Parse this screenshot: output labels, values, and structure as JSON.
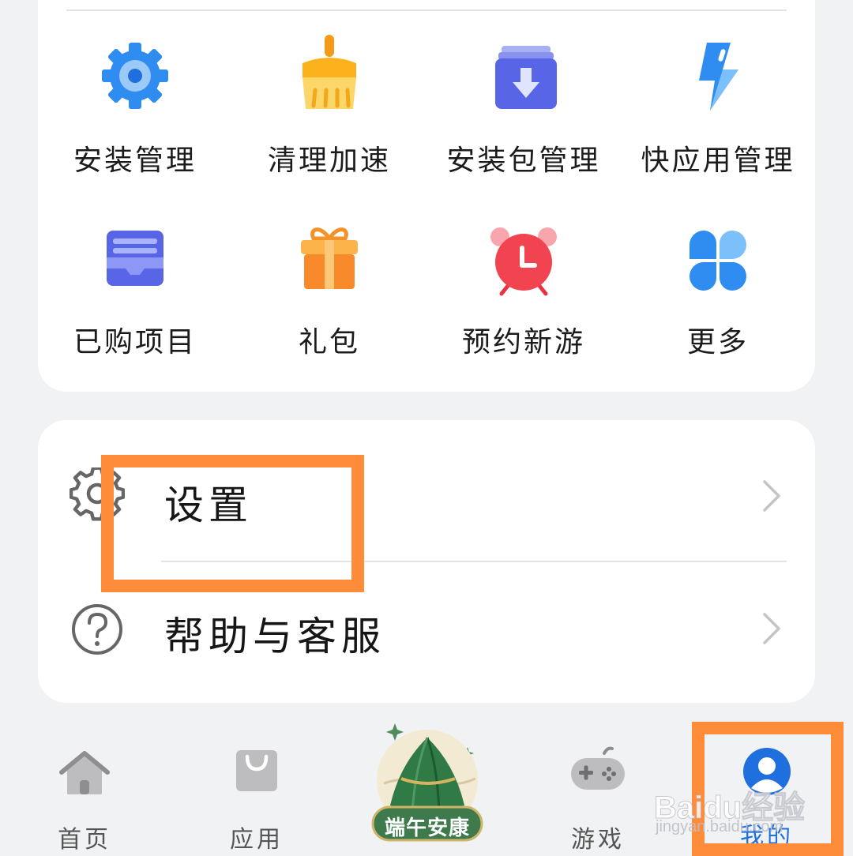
{
  "grid": {
    "items": [
      {
        "label": "安装管理",
        "icon": "gear-icon"
      },
      {
        "label": "清理加速",
        "icon": "brush-icon"
      },
      {
        "label": "安装包管理",
        "icon": "package-download-icon"
      },
      {
        "label": "快应用管理",
        "icon": "lightning-icon"
      },
      {
        "label": "已购项目",
        "icon": "purchased-tray-icon"
      },
      {
        "label": "礼包",
        "icon": "gift-icon"
      },
      {
        "label": "预约新游",
        "icon": "alarm-clock-icon"
      },
      {
        "label": "更多",
        "icon": "four-petal-grid-icon"
      }
    ]
  },
  "settings_list": {
    "items": [
      {
        "label": "设置",
        "icon": "settings-gear-icon",
        "trailing": "chevron-right-icon"
      },
      {
        "label": "帮助与客服",
        "icon": "question-circle-icon",
        "trailing": "chevron-right-icon"
      }
    ]
  },
  "bottom_nav": {
    "items": [
      {
        "label": "首页",
        "icon": "home-icon"
      },
      {
        "label": "应用",
        "icon": "shopping-bag-icon"
      },
      {
        "label": "端午安康",
        "icon": "zongzi-festival-icon"
      },
      {
        "label": "游戏",
        "icon": "gamepad-icon"
      },
      {
        "label": "我的",
        "icon": "user-avatar-icon",
        "active": true
      }
    ]
  },
  "watermark": {
    "text": "Baidu经验",
    "sub": "jingyan.baidu.com"
  },
  "colors": {
    "accent": "#1f6fde",
    "highlight": "#ff8c3a",
    "background": "#f1f2f4"
  }
}
